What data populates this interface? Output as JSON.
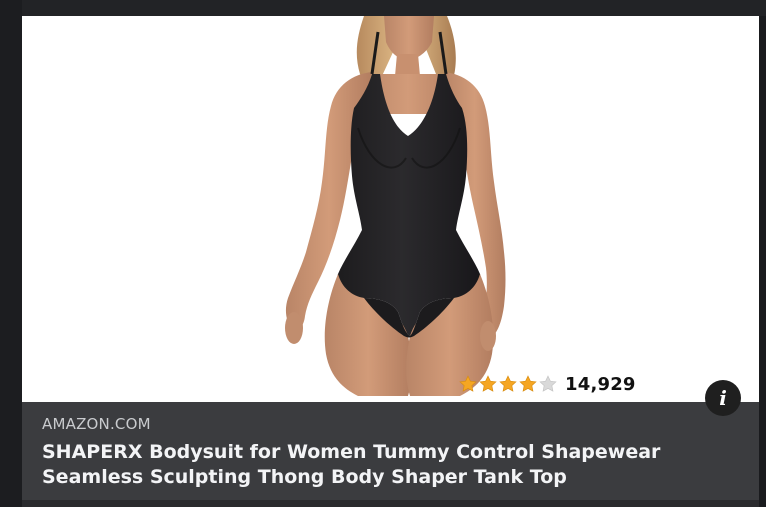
{
  "ad": {
    "source": "AMAZON.COM",
    "title": "SHAPERX Bodysuit for Women Tummy Control Shapewear Seamless Sculpting Thong Body Shaper Tank Top",
    "image_subject": "black bodysuit product photo",
    "rating": {
      "stars_filled": 4,
      "stars_total": 5,
      "review_count": "14,929",
      "star_color": "#f5a623",
      "empty_star_color": "#d9d9d9"
    },
    "info_icon": "info-icon"
  },
  "colors": {
    "page_background": "#1c1d20",
    "caption_background": "#3b3c3f",
    "caption_source": "#c9cbce",
    "caption_title": "#f3f4f6",
    "info_button": "#1f1f1f"
  }
}
